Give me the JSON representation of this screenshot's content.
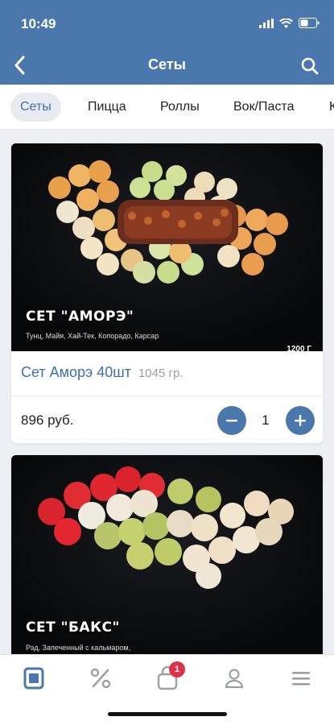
{
  "status": {
    "time": "10:49"
  },
  "nav": {
    "title": "Сеты"
  },
  "tabs": [
    {
      "label": "Сеты",
      "active": true
    },
    {
      "label": "Пицца"
    },
    {
      "label": "Роллы"
    },
    {
      "label": "Вок/Паста"
    },
    {
      "label": "К"
    }
  ],
  "products": [
    {
      "image_title": "СЕТ \"АМОРЭ\"",
      "image_subtitle": "Тунц, Майя, Хай-Тек, Копорадо, Карсар",
      "image_corner": "1200 Г",
      "name": "Сет Аморэ 40шт",
      "weight": "1045 гр.",
      "price": "896 руб.",
      "quantity": "1"
    },
    {
      "image_title": "СЕТ \"БАКС\"",
      "image_subtitle": "Рэд, Запеченный с кальмаром,"
    }
  ],
  "tabbar": {
    "cart_badge": "1"
  },
  "colors": {
    "accent": "#4a78ad",
    "badge": "#e0314b"
  }
}
